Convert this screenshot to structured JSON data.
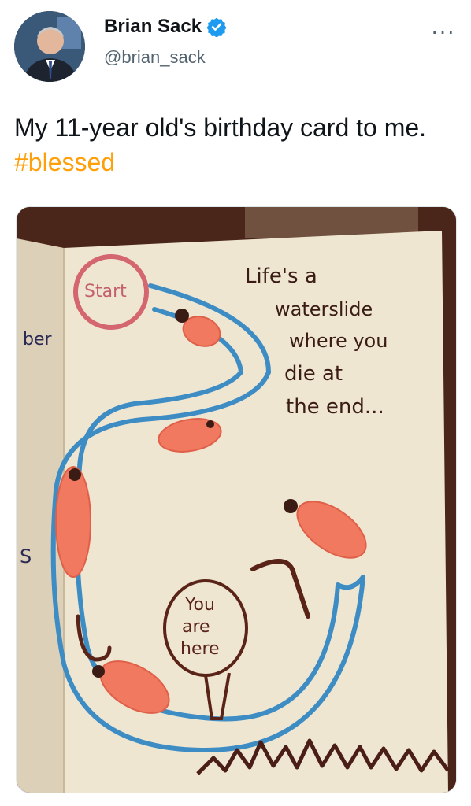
{
  "author": {
    "name": "Brian Sack",
    "handle": "@brian_sack",
    "verified": true
  },
  "menu": {
    "more_label": "···"
  },
  "tweet": {
    "text": "My 11-year old's birthday card to me.",
    "hashtag": "#blessed"
  },
  "card": {
    "start_label": "Start",
    "message_lines": [
      "Life's a",
      "waterslide",
      "where you",
      "die at",
      "the end..."
    ],
    "sign_lines": [
      "You",
      "are",
      "here"
    ],
    "left_edge_fragments": [
      "ber",
      "S"
    ]
  },
  "colors": {
    "hashtag": "#ff9f0a",
    "verified": "#1d9bf0",
    "slide": "#3d8cc4",
    "figure": "#f0795f",
    "ink": "#5a2318"
  }
}
